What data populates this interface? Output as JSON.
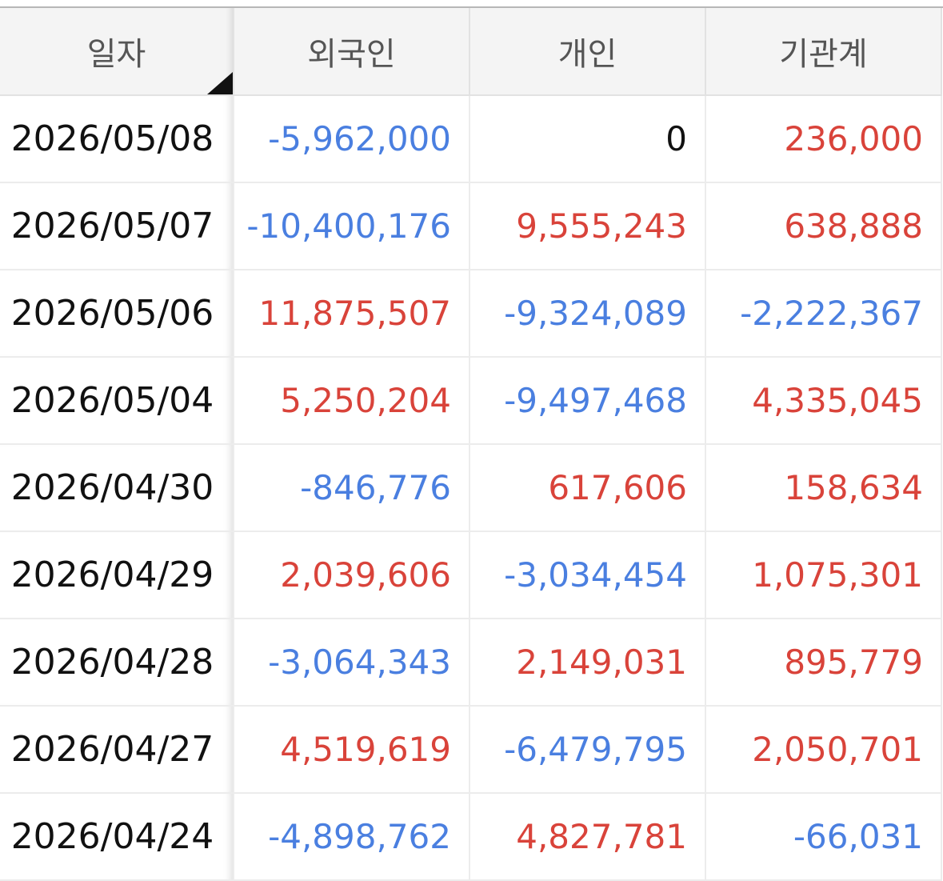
{
  "colors": {
    "positive": "#d9433a",
    "negative": "#4a7fe0",
    "neutral": "#111111"
  },
  "table": {
    "headers": [
      "일자",
      "외국인",
      "개인",
      "기관계"
    ],
    "rows": [
      [
        "2026/05/08",
        "-5,962,000",
        "0",
        "236,000"
      ],
      [
        "2026/05/07",
        "-10,400,176",
        "9,555,243",
        "638,888"
      ],
      [
        "2026/05/06",
        "11,875,507",
        "-9,324,089",
        "-2,222,367"
      ],
      [
        "2026/05/04",
        "5,250,204",
        "-9,497,468",
        "4,335,045"
      ],
      [
        "2026/04/30",
        "-846,776",
        "617,606",
        "158,634"
      ],
      [
        "2026/04/29",
        "2,039,606",
        "-3,034,454",
        "1,075,301"
      ],
      [
        "2026/04/28",
        "-3,064,343",
        "2,149,031",
        "895,779"
      ],
      [
        "2026/04/27",
        "4,519,619",
        "-6,479,795",
        "2,050,701"
      ],
      [
        "2026/04/24",
        "-4,898,762",
        "4,827,781",
        "-66,031"
      ]
    ]
  }
}
